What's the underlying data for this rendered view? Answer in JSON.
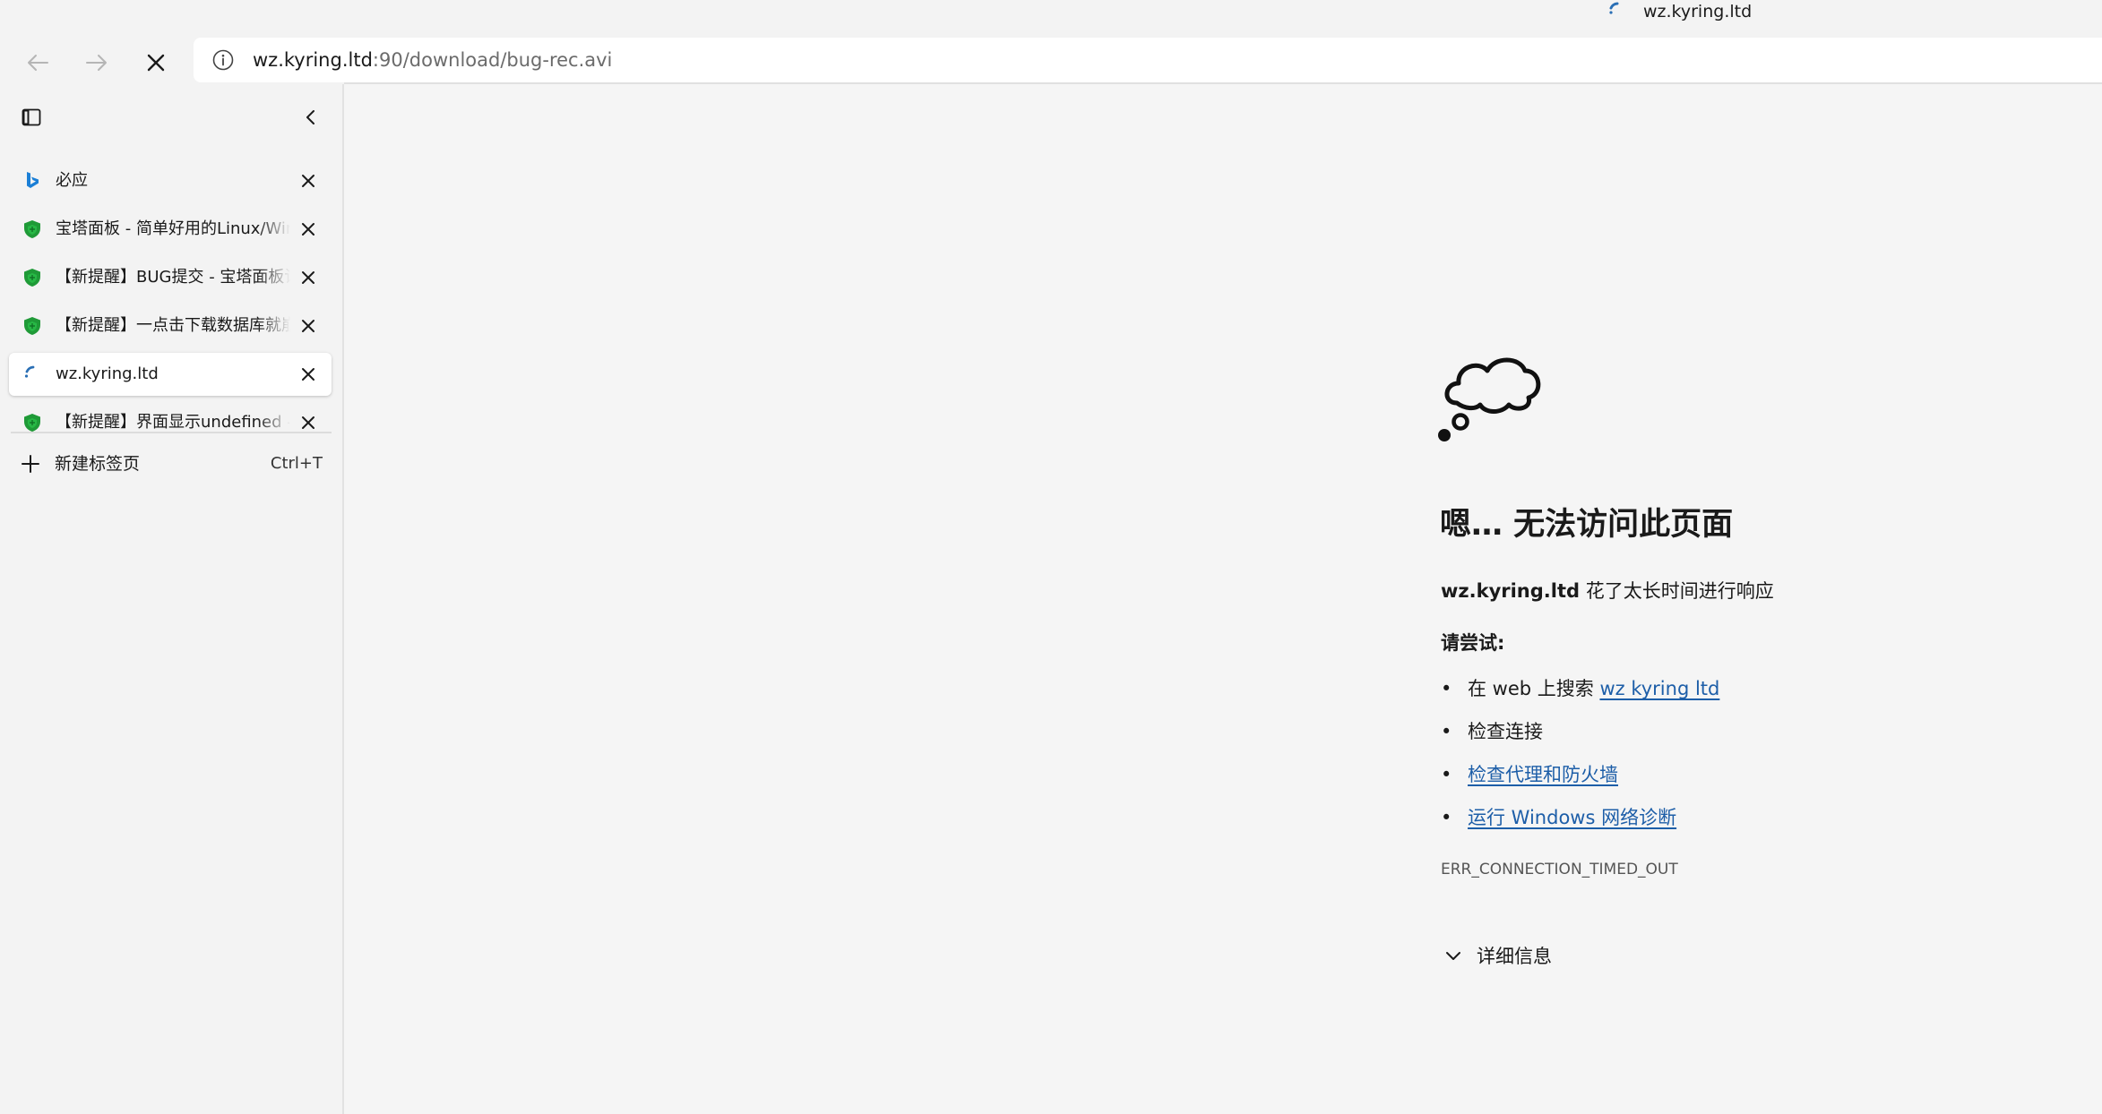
{
  "window": {
    "title": "wz.kyring.ltd"
  },
  "toolbar": {
    "url_host": "wz.kyring.ltd",
    "url_rest": ":90/download/bug-rec.avi"
  },
  "sidebar": {
    "tabs": [
      {
        "title": "必应",
        "favicon": "bing-icon"
      },
      {
        "title": "宝塔面板 - 简单好用的Linux/Windows服务器运维管理面板",
        "favicon": "bt-shield-icon"
      },
      {
        "title": "【新提醒】BUG提交 - 宝塔面板论坛",
        "favicon": "bt-shield-icon"
      },
      {
        "title": "【新提醒】一点击下载数据库就崩溃",
        "favicon": "bt-shield-icon"
      },
      {
        "title": "wz.kyring.ltd",
        "favicon": "loading-spinner-icon",
        "active": true
      },
      {
        "title": "【新提醒】界面显示undefined - 宝塔面板论坛",
        "favicon": "bt-shield-icon"
      }
    ],
    "new_tab_label": "新建标签页",
    "new_tab_shortcut": "Ctrl+T"
  },
  "error_page": {
    "heading": "嗯… 无法访问此页面",
    "host": "wz.kyring.ltd",
    "desc_suffix": " 花了太长时间进行响应",
    "try_heading": "请尝试:",
    "suggestion_search_prefix": "在 web 上搜索 ",
    "suggestion_search_link": "wz kyring ltd",
    "suggestion_check_connection": "检查连接",
    "suggestion_proxy_link": "检查代理和防火墙",
    "suggestion_diagnostics_link": "运行 Windows 网络诊断",
    "bullet": "•",
    "error_code": "ERR_CONNECTION_TIMED_OUT",
    "details_label": "详细信息"
  },
  "colors": {
    "link": "#1d5ea8",
    "background": "#f3f3f3",
    "bt_green": "#20a53a"
  }
}
